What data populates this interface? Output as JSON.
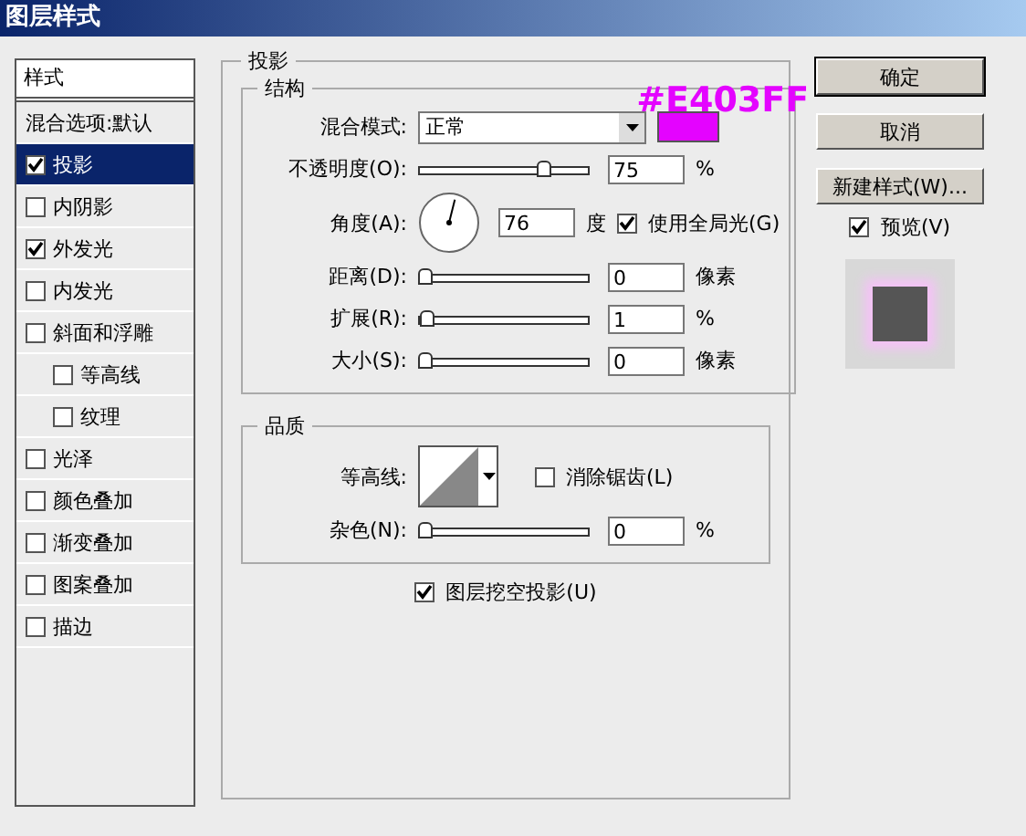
{
  "window": {
    "title": "图层样式"
  },
  "styles_list": {
    "header": "样式",
    "items": [
      {
        "kind": "plain",
        "label": "混合选项:默认",
        "selected": false
      },
      {
        "kind": "check",
        "label": "投影",
        "checked": true,
        "selected": true
      },
      {
        "kind": "check",
        "label": "内阴影",
        "checked": false,
        "selected": false
      },
      {
        "kind": "check",
        "label": "外发光",
        "checked": true,
        "selected": false
      },
      {
        "kind": "check",
        "label": "内发光",
        "checked": false,
        "selected": false
      },
      {
        "kind": "check",
        "label": "斜面和浮雕",
        "checked": false,
        "selected": false,
        "children": [
          {
            "kind": "check",
            "label": "等高线",
            "checked": false,
            "selected": false
          },
          {
            "kind": "check",
            "label": "纹理",
            "checked": false,
            "selected": false
          }
        ]
      },
      {
        "kind": "check",
        "label": "光泽",
        "checked": false,
        "selected": false
      },
      {
        "kind": "check",
        "label": "颜色叠加",
        "checked": false,
        "selected": false
      },
      {
        "kind": "check",
        "label": "渐变叠加",
        "checked": false,
        "selected": false
      },
      {
        "kind": "check",
        "label": "图案叠加",
        "checked": false,
        "selected": false
      },
      {
        "kind": "check",
        "label": "描边",
        "checked": false,
        "selected": false
      }
    ]
  },
  "panel": {
    "title": "投影",
    "structure": {
      "title": "结构",
      "blend_mode": {
        "label": "混合模式:",
        "value": "正常",
        "color": "#e403ff"
      },
      "annotation": "#E403FF",
      "rows": [
        {
          "kind": "slider",
          "label": "不透明度(O):",
          "level": 0.75,
          "value": "75",
          "unit": "%"
        },
        {
          "kind": "angle",
          "label": "角度(A):",
          "value": "76",
          "unit": "度",
          "global_light": {
            "label": "使用全局光(G)",
            "checked": true
          }
        },
        {
          "kind": "slider",
          "label": "距离(D):",
          "level": 0,
          "value": "0",
          "unit": "像素"
        },
        {
          "kind": "slider",
          "label": "扩展(R):",
          "level": 0.01,
          "value": "1",
          "unit": "%"
        },
        {
          "kind": "slider",
          "label": "大小(S):",
          "level": 0,
          "value": "0",
          "unit": "像素"
        }
      ]
    },
    "quality": {
      "title": "品质",
      "contour": {
        "label": "等高线:"
      },
      "anti_alias": {
        "label": "消除锯齿(L)",
        "checked": false
      },
      "noise": {
        "label": "杂色(N):",
        "level": 0,
        "value": "0",
        "unit": "%"
      }
    },
    "knockout": {
      "label": "图层挖空投影(U)",
      "checked": true
    }
  },
  "buttons": [
    {
      "label": "确定",
      "default": true
    },
    {
      "label": "取消",
      "default": false
    },
    {
      "label": "新建样式(W)...",
      "default": false
    }
  ],
  "preview": {
    "label": "预览(V)",
    "checked": true
  }
}
